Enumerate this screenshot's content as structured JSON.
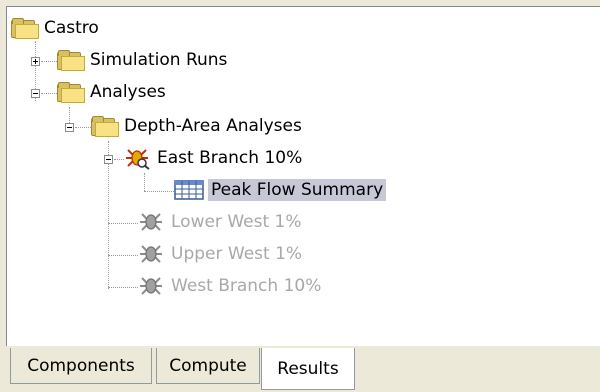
{
  "tree": {
    "root": {
      "label": "Castro",
      "icon": "folder-icon"
    },
    "simulation_runs": {
      "label": "Simulation Runs",
      "icon": "folder-icon",
      "expanded": false
    },
    "analyses": {
      "label": "Analyses",
      "icon": "folder-icon",
      "expanded": true
    },
    "depth_area_analyses": {
      "label": "Depth-Area Analyses",
      "icon": "folder-icon",
      "expanded": true
    },
    "east_branch": {
      "label": "East Branch 10%",
      "icon": "analysis-active-icon",
      "expanded": true
    },
    "peak_flow_summary": {
      "label": "Peak Flow Summary",
      "icon": "table-icon",
      "selected": true
    },
    "lower_west": {
      "label": "Lower West 1%",
      "icon": "analysis-disabled-icon",
      "disabled": true
    },
    "upper_west": {
      "label": "Upper West 1%",
      "icon": "analysis-disabled-icon",
      "disabled": true
    },
    "west_branch": {
      "label": "West Branch 10%",
      "icon": "analysis-disabled-icon",
      "disabled": true
    }
  },
  "tabs": [
    {
      "label": "Components",
      "active": false
    },
    {
      "label": "Compute",
      "active": false
    },
    {
      "label": "Results",
      "active": true
    }
  ],
  "colors": {
    "selection": "#c7c8d6",
    "disabled_text": "#a8a8a8",
    "folder": "#f7e383",
    "panel_bg": "#ece9d8"
  }
}
